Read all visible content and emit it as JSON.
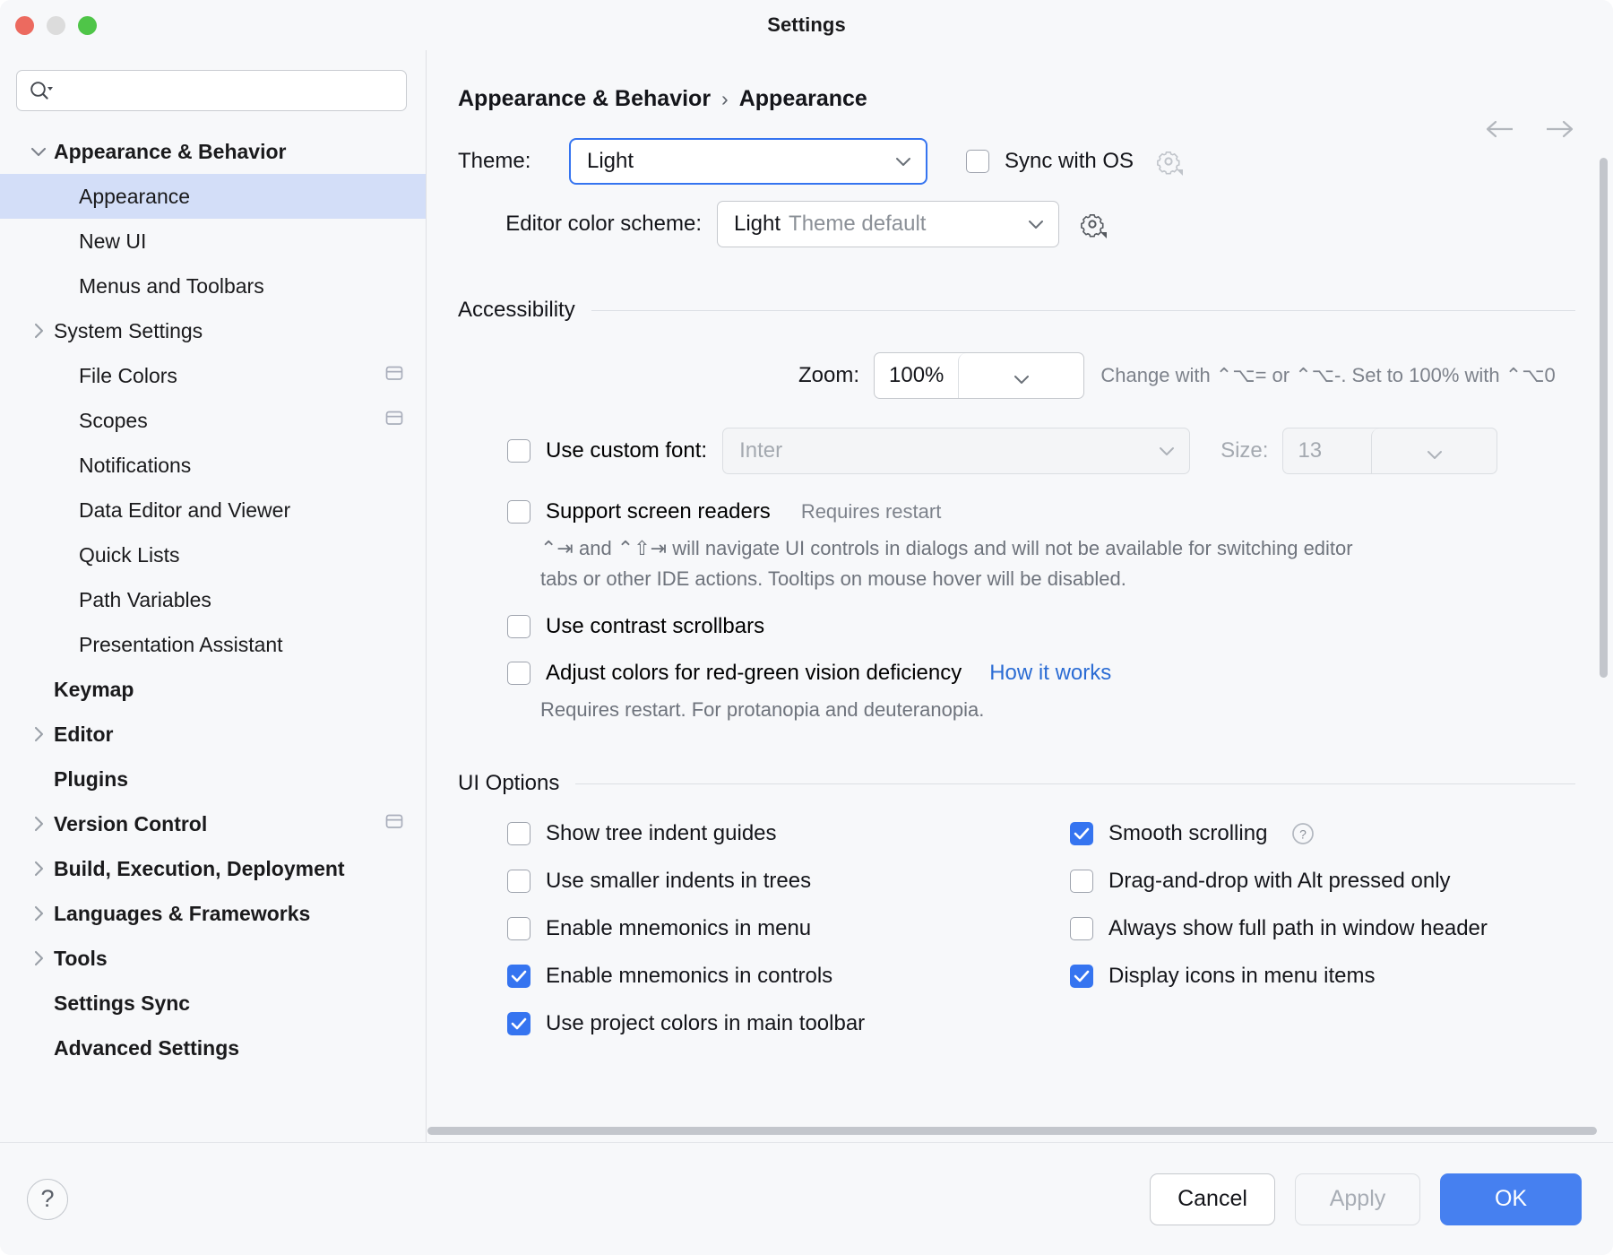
{
  "window": {
    "title": "Settings",
    "traffic_lights": [
      "close",
      "minimize",
      "maximize"
    ]
  },
  "search": {
    "placeholder": "",
    "value": ""
  },
  "sidebar": {
    "items": [
      {
        "label": "Appearance & Behavior",
        "bold": true,
        "arrow": "down",
        "indent": 0,
        "selected": false,
        "badge": false
      },
      {
        "label": "Appearance",
        "bold": false,
        "arrow": "none",
        "indent": 1,
        "selected": true,
        "badge": false
      },
      {
        "label": "New UI",
        "bold": false,
        "arrow": "none",
        "indent": 1,
        "selected": false,
        "badge": false
      },
      {
        "label": "Menus and Toolbars",
        "bold": false,
        "arrow": "none",
        "indent": 1,
        "selected": false,
        "badge": false
      },
      {
        "label": "System Settings",
        "bold": false,
        "arrow": "right",
        "indent": 0,
        "selected": false,
        "badge": false
      },
      {
        "label": "File Colors",
        "bold": false,
        "arrow": "none",
        "indent": 1,
        "selected": false,
        "badge": true
      },
      {
        "label": "Scopes",
        "bold": false,
        "arrow": "none",
        "indent": 1,
        "selected": false,
        "badge": true
      },
      {
        "label": "Notifications",
        "bold": false,
        "arrow": "none",
        "indent": 1,
        "selected": false,
        "badge": false
      },
      {
        "label": "Data Editor and Viewer",
        "bold": false,
        "arrow": "none",
        "indent": 1,
        "selected": false,
        "badge": false
      },
      {
        "label": "Quick Lists",
        "bold": false,
        "arrow": "none",
        "indent": 1,
        "selected": false,
        "badge": false
      },
      {
        "label": "Path Variables",
        "bold": false,
        "arrow": "none",
        "indent": 1,
        "selected": false,
        "badge": false
      },
      {
        "label": "Presentation Assistant",
        "bold": false,
        "arrow": "none",
        "indent": 1,
        "selected": false,
        "badge": false
      },
      {
        "label": "Keymap",
        "bold": true,
        "arrow": "none",
        "indent": 0,
        "selected": false,
        "badge": false
      },
      {
        "label": "Editor",
        "bold": true,
        "arrow": "right",
        "indent": 0,
        "selected": false,
        "badge": false
      },
      {
        "label": "Plugins",
        "bold": true,
        "arrow": "none",
        "indent": 0,
        "selected": false,
        "badge": false
      },
      {
        "label": "Version Control",
        "bold": true,
        "arrow": "right",
        "indent": 0,
        "selected": false,
        "badge": true
      },
      {
        "label": "Build, Execution, Deployment",
        "bold": true,
        "arrow": "right",
        "indent": 0,
        "selected": false,
        "badge": false
      },
      {
        "label": "Languages & Frameworks",
        "bold": true,
        "arrow": "right",
        "indent": 0,
        "selected": false,
        "badge": false
      },
      {
        "label": "Tools",
        "bold": true,
        "arrow": "right",
        "indent": 0,
        "selected": false,
        "badge": false
      },
      {
        "label": "Settings Sync",
        "bold": true,
        "arrow": "none",
        "indent": 0,
        "selected": false,
        "badge": false
      },
      {
        "label": "Advanced Settings",
        "bold": true,
        "arrow": "none",
        "indent": 0,
        "selected": false,
        "badge": false
      }
    ]
  },
  "breadcrumb": {
    "root": "Appearance & Behavior",
    "separator": "›",
    "current": "Appearance"
  },
  "theme": {
    "label": "Theme:",
    "value": "Light",
    "sync_with_os_label": "Sync with OS",
    "sync_with_os_checked": false,
    "editor_scheme_label": "Editor color scheme:",
    "editor_scheme_value": "Light",
    "editor_scheme_suffix": "Theme default"
  },
  "accessibility": {
    "title": "Accessibility",
    "zoom_label": "Zoom:",
    "zoom_value": "100%",
    "zoom_hint": "Change with ⌃⌥= or ⌃⌥-. Set to 100% with ⌃⌥0",
    "custom_font_label": "Use custom font:",
    "custom_font_checked": false,
    "custom_font_value": "Inter",
    "size_label": "Size:",
    "size_value": "13",
    "screen_readers_label": "Support screen readers",
    "screen_readers_checked": false,
    "screen_readers_note": "Requires restart",
    "screen_readers_desc_line1": "⌃⇥ and ⌃⇧⇥ will navigate UI controls in dialogs and will not be available for switching editor",
    "screen_readers_desc_line2": "tabs or other IDE actions. Tooltips on mouse hover will be disabled.",
    "contrast_scrollbars_label": "Use contrast scrollbars",
    "contrast_scrollbars_checked": false,
    "red_green_label": "Adjust colors for red-green vision deficiency",
    "red_green_checked": false,
    "red_green_link": "How it works",
    "red_green_desc": "Requires restart. For protanopia and deuteranopia."
  },
  "ui_options": {
    "title": "UI Options",
    "left": [
      {
        "label": "Show tree indent guides",
        "checked": false,
        "help": false
      },
      {
        "label": "Use smaller indents in trees",
        "checked": false,
        "help": false
      },
      {
        "label": "Enable mnemonics in menu",
        "checked": false,
        "help": false
      },
      {
        "label": "Enable mnemonics in controls",
        "checked": true,
        "help": false
      },
      {
        "label": "Use project colors in main toolbar",
        "checked": true,
        "help": false
      }
    ],
    "right": [
      {
        "label": "Smooth scrolling",
        "checked": true,
        "help": true
      },
      {
        "label": "Drag-and-drop with Alt pressed only",
        "checked": false,
        "help": false
      },
      {
        "label": "Always show full path in window header",
        "checked": false,
        "help": false
      },
      {
        "label": "Display icons in menu items",
        "checked": true,
        "help": false
      }
    ]
  },
  "footer": {
    "help_label": "?",
    "cancel_label": "Cancel",
    "apply_label": "Apply",
    "ok_label": "OK"
  },
  "colors": {
    "accent": "#3574f0",
    "primary_button": "#4680f0",
    "selection": "#d3def8",
    "link": "#2b6cd4",
    "background": "#f7f8fa"
  }
}
